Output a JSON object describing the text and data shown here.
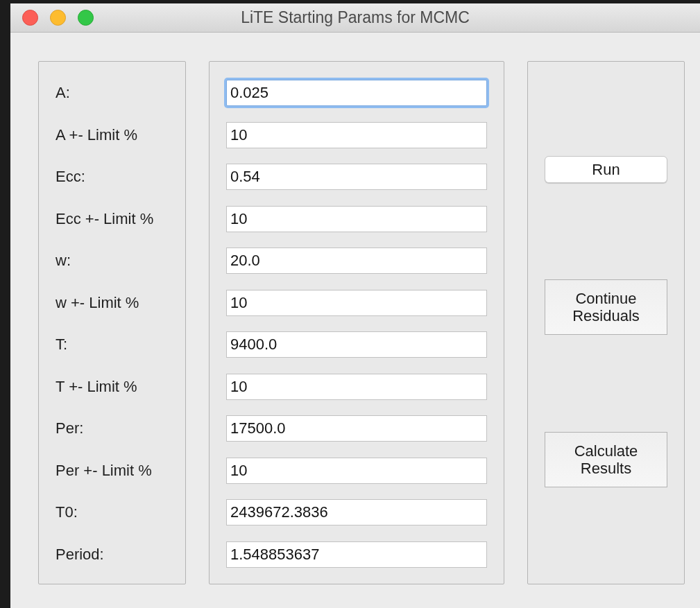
{
  "window": {
    "title": "LiTE Starting Params for MCMC"
  },
  "params": [
    {
      "label": "A:",
      "value": "0.025",
      "focused": true
    },
    {
      "label": "A +- Limit %",
      "value": "10",
      "focused": false
    },
    {
      "label": "Ecc:",
      "value": "0.54",
      "focused": false
    },
    {
      "label": "Ecc +- Limit %",
      "value": "10",
      "focused": false
    },
    {
      "label": "w:",
      "value": "20.0",
      "focused": false
    },
    {
      "label": "w +- Limit %",
      "value": "10",
      "focused": false
    },
    {
      "label": "T:",
      "value": "9400.0",
      "focused": false
    },
    {
      "label": "T +- Limit %",
      "value": "10",
      "focused": false
    },
    {
      "label": "Per:",
      "value": "17500.0",
      "focused": false
    },
    {
      "label": "Per +- Limit %",
      "value": "10",
      "focused": false
    },
    {
      "label": "T0:",
      "value": "2439672.3836",
      "focused": false
    },
    {
      "label": "Period:",
      "value": "1.548853637",
      "focused": false
    }
  ],
  "buttons": [
    {
      "label": "Run",
      "kind": "default"
    },
    {
      "label": "Continue\nResiduals",
      "kind": "push"
    },
    {
      "label": "Calculate\nResults",
      "kind": "push"
    }
  ]
}
